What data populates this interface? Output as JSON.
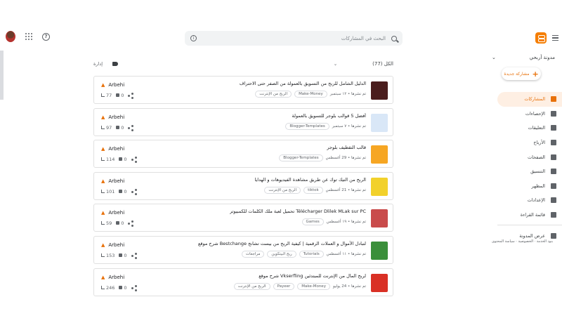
{
  "header": {
    "search_placeholder": "البحث في المشاركات"
  },
  "toolbar": {
    "action_label": "إدارة",
    "all_label": "الكل (77)"
  },
  "sidebar": {
    "blog_name": "مدونة أربحي",
    "new_post_label": "مشاركة جديدة",
    "items": [
      {
        "label": "المشاركات",
        "icon": "posts-icon",
        "active": true
      },
      {
        "label": "الإحصاءات",
        "icon": "stats-icon"
      },
      {
        "label": "التعليقات",
        "icon": "comments-icon"
      },
      {
        "label": "الأرباح",
        "icon": "dollar-icon"
      },
      {
        "label": "الصفحات",
        "icon": "pages-icon"
      },
      {
        "label": "التنسيق",
        "icon": "layout-icon"
      },
      {
        "label": "المظهر",
        "icon": "theme-icon"
      },
      {
        "label": "الإعدادات",
        "icon": "gear-icon"
      },
      {
        "label": "قائمة القراءة",
        "icon": "bookmark-icon"
      },
      {
        "label": "عرض المدونة",
        "icon": "external-icon"
      }
    ],
    "footer": "بنود الخدمة · الخصوصية · سياسة المحتوى"
  },
  "posts": [
    {
      "title": "الدليل الشامل للربح من التسويق بالعمولة من الصفر حتى الاحتراف",
      "date": "تم نشرها • ١٢ سبتمبر",
      "labels": [
        "Make-Money",
        "الربح من الإنترنت"
      ],
      "author": "Arbehi",
      "views": "77",
      "comments": "0",
      "thumb_color": "#4a1d1d"
    },
    {
      "title": "أفضل 5 قوالب بلوجر للتسويق بالعمولة",
      "date": "تم نشرها • ٧ سبتمبر",
      "labels": [
        "Blogger-Templates"
      ],
      "author": "Arbehi",
      "views": "97",
      "comments": "0",
      "thumb_color": "#d9e7f7"
    },
    {
      "title": "قالب التقطيف بلوجر",
      "date": "تم نشرها • 29 أغسطس",
      "labels": [
        "Blogger-Templates"
      ],
      "author": "Arbehi",
      "views": "114",
      "comments": "0",
      "thumb_color": "#f6a623"
    },
    {
      "title": "الربح من التيك توك عن طريق مشاهدة الفيديوهات و الهدايا",
      "date": "تم نشرها • 21 أغسطس",
      "labels": [
        "tiktok",
        "الربح من الإنترنت"
      ],
      "author": "Arbehi",
      "views": "101",
      "comments": "0",
      "thumb_color": "#f2d12b"
    },
    {
      "title": "تحميل لعبة ملك الكلمات للكمبيوتر Télécharger Dlilek MLak sur PC",
      "date": "تم نشرها • ١٩ أغسطس",
      "labels": [
        "Games"
      ],
      "author": "Arbehi",
      "views": "59",
      "comments": "0",
      "thumb_color": "#c94b4b"
    },
    {
      "title": "شرح موقع Bestchange لتبادل الأموال و العملات الرقمية | كيفية الربح من بيست تشانج",
      "date": "تم نشرها • ١١ أغسطس",
      "labels": [
        "Tutorials",
        "ربح البيتكوين",
        "مراجعات"
      ],
      "author": "Arbehi",
      "views": "153",
      "comments": "0",
      "thumb_color": "#3a8f3a"
    },
    {
      "title": "شرح موقع Vkserfling لربح المال من الإنترنت للمبتدئين",
      "date": "تم نشرها • 24 يوليو",
      "labels": [
        "Make-Money",
        "Payeer",
        "الربح من الإنترنت"
      ],
      "author": "Arbehi",
      "views": "246",
      "comments": "0",
      "thumb_color": "#d93025"
    }
  ]
}
